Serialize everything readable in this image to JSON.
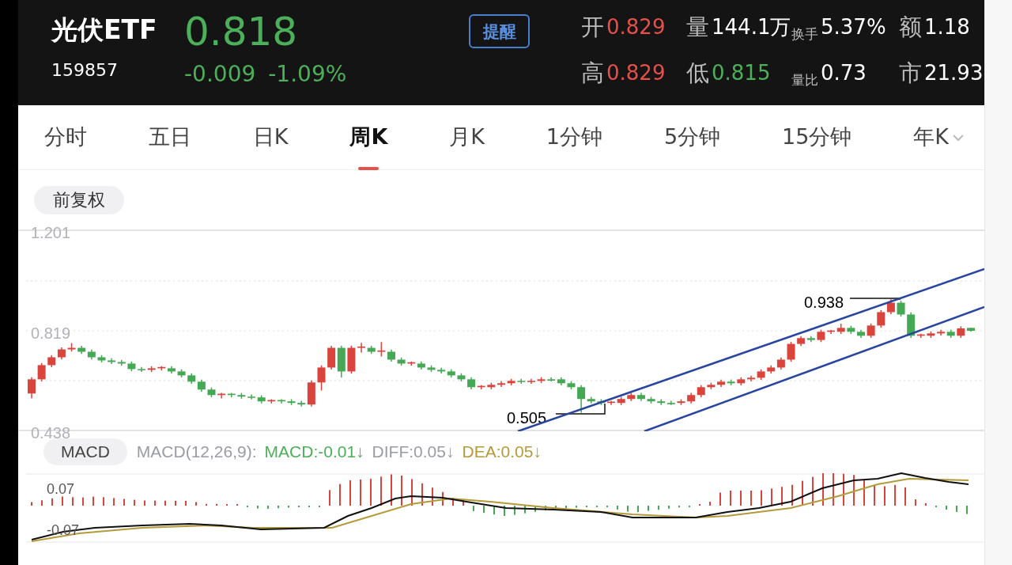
{
  "header": {
    "name": "光伏ETF",
    "code": "159857",
    "price": "0.818",
    "change": "-0.009",
    "change_percent": "-1.09%",
    "color": "#4caf5a",
    "alert_button": "提醒",
    "stats": [
      {
        "label": "开",
        "kind": "large",
        "value": "0.829",
        "color": "#e5504a"
      },
      {
        "label": "量",
        "kind": "large",
        "value": "144.1万",
        "color": "#ffffff"
      },
      {
        "label": "换手",
        "kind": "small",
        "value": "5.37%",
        "color": "#ffffff"
      },
      {
        "label": "额",
        "kind": "large",
        "value": "1.18",
        "color": "#ffffff"
      },
      {
        "label": "高",
        "kind": "large",
        "value": "0.829",
        "color": "#e5504a"
      },
      {
        "label": "低",
        "kind": "large",
        "value": "0.815",
        "color": "#4caf5a"
      },
      {
        "label": "量比",
        "kind": "small",
        "value": "0.73",
        "color": "#ffffff"
      },
      {
        "label": "市",
        "kind": "large",
        "value": "21.93",
        "color": "#ffffff"
      }
    ]
  },
  "tabs": [
    {
      "label": "分时",
      "selected": false,
      "dropdown": false
    },
    {
      "label": "五日",
      "selected": false,
      "dropdown": false
    },
    {
      "label": "日K",
      "selected": false,
      "dropdown": false
    },
    {
      "label": "周K",
      "selected": true,
      "dropdown": false
    },
    {
      "label": "月K",
      "selected": false,
      "dropdown": false
    },
    {
      "label": "1分钟",
      "selected": false,
      "dropdown": false
    },
    {
      "label": "5分钟",
      "selected": false,
      "dropdown": false
    },
    {
      "label": "15分钟",
      "selected": false,
      "dropdown": false
    },
    {
      "label": "年K",
      "selected": false,
      "dropdown": true
    }
  ],
  "adjustment_chip": "前复权",
  "price_chart": {
    "high_marker": "0.938",
    "low_marker": "0.505",
    "chart_data": {
      "type": "candlestick",
      "ylim": [
        0.438,
        1.201
      ],
      "yticks": [
        {
          "value": 1.201,
          "label": "1.201"
        },
        {
          "value": 0.819,
          "label": "0.819"
        },
        {
          "value": 0.438,
          "label": "0.438"
        }
      ],
      "ohlc": [
        [
          0.579,
          0.641,
          0.56,
          0.633
        ],
        [
          0.633,
          0.695,
          0.625,
          0.687
        ],
        [
          0.687,
          0.725,
          0.679,
          0.717
        ],
        [
          0.717,
          0.755,
          0.709,
          0.747
        ],
        [
          0.747,
          0.771,
          0.739,
          0.753
        ],
        [
          0.753,
          0.761,
          0.73,
          0.738
        ],
        [
          0.738,
          0.746,
          0.709,
          0.717
        ],
        [
          0.717,
          0.725,
          0.697,
          0.705
        ],
        [
          0.705,
          0.713,
          0.691,
          0.699
        ],
        [
          0.699,
          0.707,
          0.685,
          0.693
        ],
        [
          0.693,
          0.701,
          0.664,
          0.672
        ],
        [
          0.672,
          0.68,
          0.661,
          0.669
        ],
        [
          0.669,
          0.683,
          0.661,
          0.675
        ],
        [
          0.675,
          0.683,
          0.667,
          0.68
        ],
        [
          0.675,
          0.683,
          0.655,
          0.663
        ],
        [
          0.663,
          0.671,
          0.64,
          0.648
        ],
        [
          0.648,
          0.656,
          0.616,
          0.624
        ],
        [
          0.624,
          0.632,
          0.586,
          0.594
        ],
        [
          0.594,
          0.602,
          0.565,
          0.573
        ],
        [
          0.573,
          0.581,
          0.56,
          0.578
        ],
        [
          0.578,
          0.581,
          0.565,
          0.573
        ],
        [
          0.573,
          0.581,
          0.559,
          0.567
        ],
        [
          0.567,
          0.575,
          0.556,
          0.564
        ],
        [
          0.564,
          0.572,
          0.541,
          0.549
        ],
        [
          0.549,
          0.557,
          0.541,
          0.554
        ],
        [
          0.554,
          0.557,
          0.541,
          0.549
        ],
        [
          0.549,
          0.557,
          0.535,
          0.543
        ],
        [
          0.543,
          0.551,
          0.529,
          0.537
        ],
        [
          0.537,
          0.629,
          0.529,
          0.621
        ],
        [
          0.621,
          0.686,
          0.59,
          0.678
        ],
        [
          0.678,
          0.761,
          0.67,
          0.753
        ],
        [
          0.753,
          0.761,
          0.64,
          0.663
        ],
        [
          0.663,
          0.761,
          0.655,
          0.753
        ],
        [
          0.753,
          0.772,
          0.735,
          0.758
        ],
        [
          0.753,
          0.761,
          0.73,
          0.738
        ],
        [
          0.738,
          0.775,
          0.72,
          0.743
        ],
        [
          0.738,
          0.746,
          0.7,
          0.708
        ],
        [
          0.708,
          0.716,
          0.685,
          0.693
        ],
        [
          0.693,
          0.701,
          0.685,
          0.698
        ],
        [
          0.693,
          0.701,
          0.67,
          0.678
        ],
        [
          0.678,
          0.686,
          0.661,
          0.669
        ],
        [
          0.669,
          0.677,
          0.655,
          0.663
        ],
        [
          0.663,
          0.671,
          0.64,
          0.648
        ],
        [
          0.648,
          0.656,
          0.625,
          0.633
        ],
        [
          0.633,
          0.641,
          0.595,
          0.603
        ],
        [
          0.603,
          0.611,
          0.595,
          0.608
        ],
        [
          0.603,
          0.62,
          0.595,
          0.612
        ],
        [
          0.612,
          0.626,
          0.604,
          0.618
        ],
        [
          0.618,
          0.635,
          0.61,
          0.627
        ],
        [
          0.627,
          0.635,
          0.616,
          0.624
        ],
        [
          0.624,
          0.635,
          0.616,
          0.627
        ],
        [
          0.627,
          0.641,
          0.619,
          0.633
        ],
        [
          0.633,
          0.641,
          0.625,
          0.628
        ],
        [
          0.633,
          0.641,
          0.61,
          0.618
        ],
        [
          0.618,
          0.626,
          0.595,
          0.603
        ],
        [
          0.603,
          0.611,
          0.505,
          0.558
        ],
        [
          0.558,
          0.566,
          0.541,
          0.549
        ],
        [
          0.549,
          0.557,
          0.535,
          0.543
        ],
        [
          0.543,
          0.551,
          0.535,
          0.548
        ],
        [
          0.543,
          0.566,
          0.535,
          0.558
        ],
        [
          0.558,
          0.581,
          0.55,
          0.573
        ],
        [
          0.573,
          0.581,
          0.55,
          0.558
        ],
        [
          0.558,
          0.566,
          0.541,
          0.549
        ],
        [
          0.549,
          0.557,
          0.535,
          0.543
        ],
        [
          0.543,
          0.551,
          0.535,
          0.538
        ],
        [
          0.543,
          0.557,
          0.535,
          0.549
        ],
        [
          0.549,
          0.581,
          0.541,
          0.573
        ],
        [
          0.573,
          0.611,
          0.565,
          0.603
        ],
        [
          0.603,
          0.62,
          0.595,
          0.612
        ],
        [
          0.612,
          0.632,
          0.604,
          0.624
        ],
        [
          0.624,
          0.632,
          0.61,
          0.618
        ],
        [
          0.618,
          0.641,
          0.61,
          0.633
        ],
        [
          0.633,
          0.647,
          0.625,
          0.639
        ],
        [
          0.639,
          0.671,
          0.631,
          0.663
        ],
        [
          0.663,
          0.686,
          0.655,
          0.678
        ],
        [
          0.678,
          0.716,
          0.67,
          0.708
        ],
        [
          0.708,
          0.776,
          0.7,
          0.768
        ],
        [
          0.768,
          0.798,
          0.76,
          0.79
        ],
        [
          0.79,
          0.798,
          0.775,
          0.783
        ],
        [
          0.783,
          0.822,
          0.775,
          0.814
        ],
        [
          0.814,
          0.822,
          0.806,
          0.819
        ],
        [
          0.814,
          0.845,
          0.806,
          0.829
        ],
        [
          0.829,
          0.837,
          0.806,
          0.814
        ],
        [
          0.814,
          0.822,
          0.791,
          0.799
        ],
        [
          0.799,
          0.846,
          0.791,
          0.838
        ],
        [
          0.838,
          0.897,
          0.83,
          0.889
        ],
        [
          0.889,
          0.938,
          0.881,
          0.925
        ],
        [
          0.925,
          0.933,
          0.872,
          0.88
        ],
        [
          0.88,
          0.888,
          0.791,
          0.799
        ],
        [
          0.799,
          0.807,
          0.791,
          0.804
        ],
        [
          0.799,
          0.816,
          0.791,
          0.808
        ],
        [
          0.808,
          0.822,
          0.8,
          0.814
        ],
        [
          0.814,
          0.822,
          0.791,
          0.799
        ],
        [
          0.799,
          0.835,
          0.791,
          0.827
        ],
        [
          0.829,
          0.829,
          0.815,
          0.818
        ]
      ]
    }
  },
  "macd": {
    "chip": "MACD",
    "legend": [
      {
        "text": "MACD(12,26,9):",
        "color": "#9a9ca3"
      },
      {
        "text": "MACD:-0.01↓",
        "color": "#4caf5a"
      },
      {
        "text": "DIFF:0.05↓",
        "color": "#9a9ca3"
      },
      {
        "text": "DEA:0.05↓",
        "color": "#b59a3a"
      }
    ],
    "y_labels": [
      "0.07",
      "-0.07"
    ]
  }
}
